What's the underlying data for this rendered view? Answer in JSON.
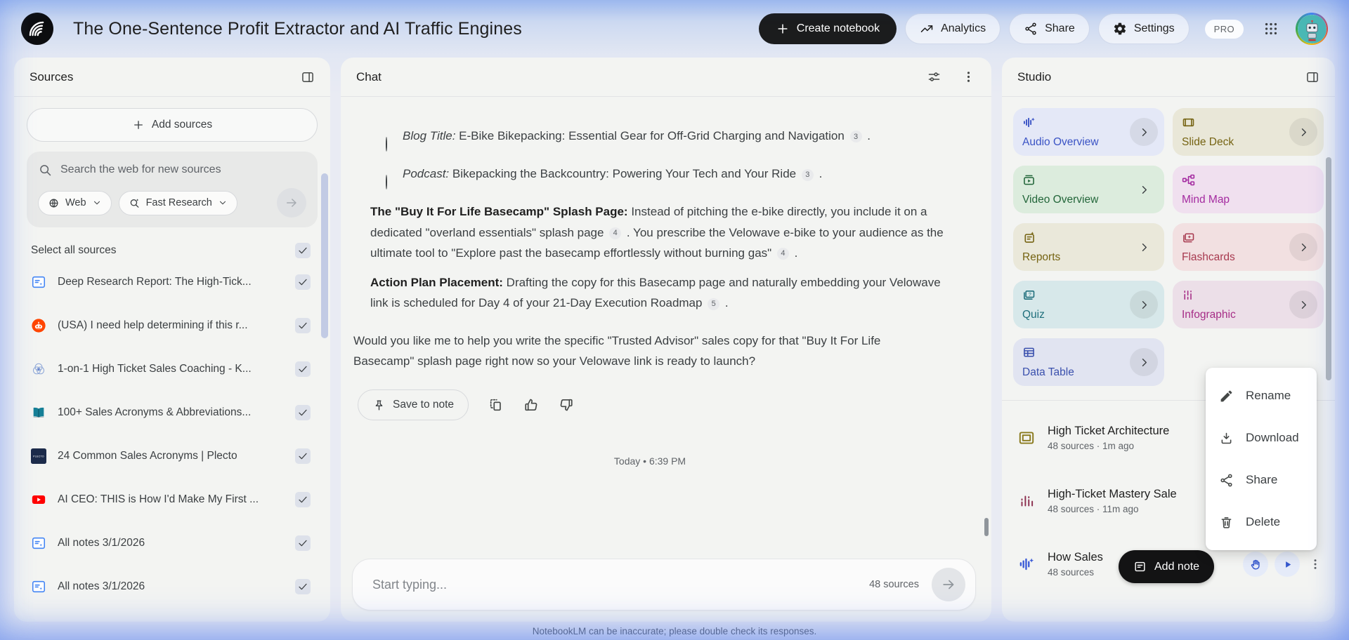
{
  "page": {
    "disclaimer": "NotebookLM can be inaccurate; please double check its responses."
  },
  "header": {
    "title": "The One-Sentence Profit Extractor and AI Traffic Engines",
    "create_notebook": "Create notebook",
    "analytics": "Analytics",
    "share": "Share",
    "settings": "Settings",
    "pro": "PRO"
  },
  "sources": {
    "title": "Sources",
    "add_button": "Add sources",
    "search_placeholder": "Search the web for new sources",
    "web_filter": "Web",
    "research_mode": "Fast Research",
    "select_all": "Select all sources",
    "items": [
      {
        "icon": "report-doc-icon",
        "title": "Deep Research Report: The High-Tick...",
        "checked": true
      },
      {
        "icon": "reddit-icon",
        "title": "(USA) I need help determining if this r...",
        "checked": true
      },
      {
        "icon": "venn-icon",
        "title": "1-on-1 High Ticket Sales Coaching - K...",
        "checked": true
      },
      {
        "icon": "book-icon",
        "title": "100+ Sales Acronyms & Abbreviations...",
        "checked": true
      },
      {
        "icon": "plecto-icon",
        "title": "24 Common Sales Acronyms | Plecto",
        "checked": true
      },
      {
        "icon": "youtube-icon",
        "title": "AI CEO: THIS is How I'd Make My First ...",
        "checked": true
      },
      {
        "icon": "report-doc-icon",
        "title": "All notes 3/1/2026",
        "checked": true
      },
      {
        "icon": "report-doc-icon",
        "title": "All notes 3/1/2026",
        "checked": true
      }
    ]
  },
  "chat": {
    "title": "Chat",
    "bullets": [
      {
        "marker": "circle",
        "lead": "Blog Title:",
        "lead_style": "italic",
        "segments": [
          {
            "text": " E-Bike Bikepacking: Essential Gear for Off-Grid Charging and Navigation "
          },
          {
            "cite": "3"
          },
          {
            "text": " ."
          }
        ]
      },
      {
        "marker": "circle",
        "lead": "Podcast:",
        "lead_style": "italic",
        "segments": [
          {
            "text": " Bikepacking the Backcountry: Powering Your Tech and Your Ride "
          },
          {
            "cite": "3"
          },
          {
            "text": " ."
          }
        ]
      },
      {
        "marker": "disc",
        "lead": "The \"Buy It For Life Basecamp\" Splash Page:",
        "lead_style": "bold",
        "segments": [
          {
            "text": " Instead of pitching the e-bike directly, you include it on a dedicated \"overland essentials\" splash page "
          },
          {
            "cite": "4"
          },
          {
            "text": " . You prescribe the Velowave e-bike to your audience as the ultimate tool to \"Explore past the basecamp effortlessly without burning gas\" "
          },
          {
            "cite": "4"
          },
          {
            "text": " ."
          }
        ]
      },
      {
        "marker": "disc",
        "lead": "Action Plan Placement:",
        "lead_style": "bold",
        "segments": [
          {
            "text": " Drafting the copy for this Basecamp page and naturally embedding your Velowave link is scheduled for Day 4 of your 21-Day Execution Roadmap "
          },
          {
            "cite": "5"
          },
          {
            "text": " ."
          }
        ]
      }
    ],
    "closing": "Would you like me to help you write the specific \"Trusted Advisor\" sales copy for that \"Buy It For Life Basecamp\" splash page right now so your Velowave link is ready to launch?",
    "save_to_note": "Save to note",
    "timestamp": "Today • 6:39 PM",
    "input_placeholder": "Start typing...",
    "sources_count": "48 sources"
  },
  "studio": {
    "title": "Studio",
    "cards": [
      {
        "id": "audio-overview",
        "label": "Audio Overview",
        "icon": "audio-waveform-icon",
        "bg": "#e4e8f7",
        "fg": "#3a53c5",
        "chevron": "circle"
      },
      {
        "id": "slide-deck",
        "label": "Slide Deck",
        "icon": "slide-deck-icon",
        "bg": "#e9e7d8",
        "fg": "#756312",
        "chevron": "circle"
      },
      {
        "id": "video-overview",
        "label": "Video Overview",
        "icon": "video-overview-icon",
        "bg": "#dcecdd",
        "fg": "#23663a",
        "chevron": "plain"
      },
      {
        "id": "mind-map",
        "label": "Mind Map",
        "icon": "mind-map-icon",
        "bg": "#f0e0ef",
        "fg": "#a42ba0",
        "chevron": "none"
      },
      {
        "id": "reports",
        "label": "Reports",
        "icon": "reports-icon",
        "bg": "#eae8da",
        "fg": "#756312",
        "chevron": "plain"
      },
      {
        "id": "flashcards",
        "label": "Flashcards",
        "icon": "flashcards-icon",
        "bg": "#f2e0e1",
        "fg": "#a83a50",
        "chevron": "circle"
      },
      {
        "id": "quiz",
        "label": "Quiz",
        "icon": "quiz-icon",
        "bg": "#d7e8ea",
        "fg": "#1f6f7c",
        "chevron": "circle"
      },
      {
        "id": "infographic",
        "label": "Infographic",
        "icon": "infographic-icon",
        "bg": "#ecdfe8",
        "fg": "#a62c86",
        "chevron": "circle"
      },
      {
        "id": "data-table",
        "label": "Data Table",
        "icon": "data-table-icon",
        "bg": "#e1e4f1",
        "fg": "#3a50ad",
        "chevron": "circle"
      }
    ],
    "docs": [
      {
        "icon": "slide-doc-icon",
        "color": "#8a7a1e",
        "title": "High Ticket Architecture",
        "meta": "48 sources · 1m ago"
      },
      {
        "icon": "bar-chart-icon",
        "color": "#8c2f4f",
        "title": "High-Ticket Mastery Sale",
        "meta": "48 sources · 11m ago"
      },
      {
        "icon": "audio-doc-icon",
        "color": "#3b5bd7",
        "title": "How Sales",
        "meta": "48 sources",
        "has_actions": true
      }
    ],
    "menu": [
      {
        "icon": "pencil-icon",
        "label": "Rename"
      },
      {
        "icon": "download-icon",
        "label": "Download"
      },
      {
        "icon": "share-nodes-icon",
        "label": "Share"
      },
      {
        "icon": "trash-icon",
        "label": "Delete"
      }
    ],
    "add_note": "Add note"
  }
}
